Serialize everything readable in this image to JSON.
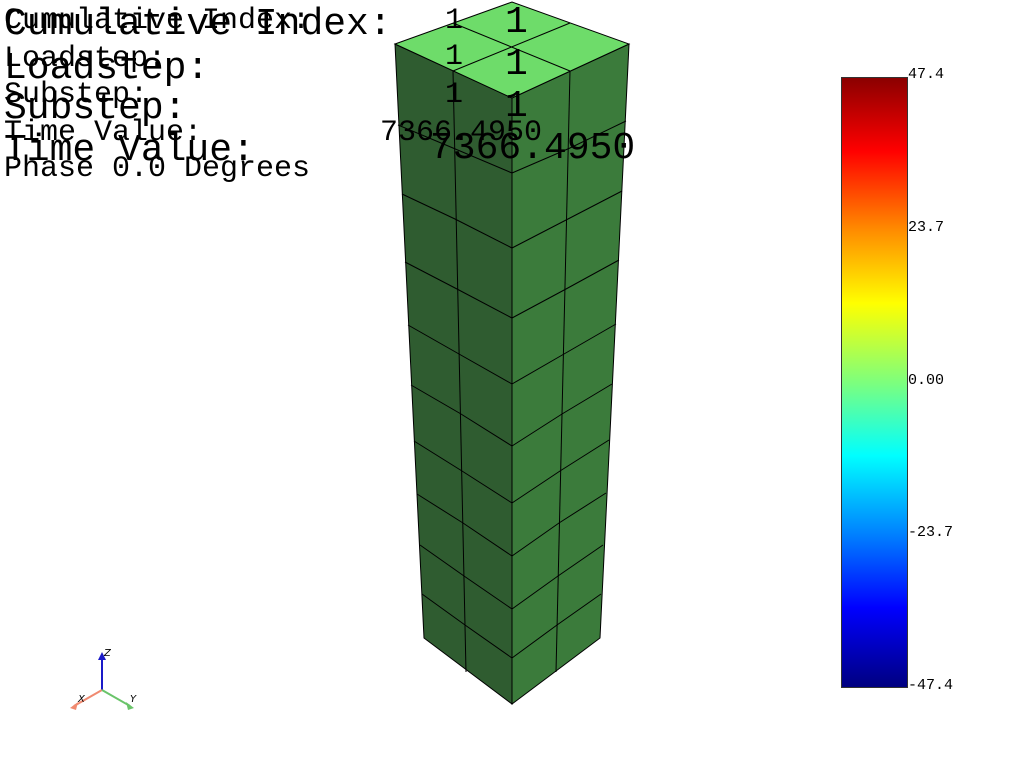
{
  "overlay": {
    "cumulative_index_label": "Cumulative Index:",
    "cumulative_index_value": "1",
    "loadstep_label": "Loadstep:",
    "loadstep_value": "1",
    "substep_label": "Substep:",
    "substep_value": "1",
    "time_value_label": "Time Value:",
    "time_value": "7366.4950",
    "phase_text": "Phase 0.0 Degrees"
  },
  "colorbar": {
    "ticks": [
      "47.4",
      "23.7",
      "0.00",
      "-23.7",
      "-47.4"
    ],
    "range": [
      -47.4,
      47.4
    ],
    "colors": [
      "#8b0000",
      "#ff0000",
      "#ff8c00",
      "#ffff00",
      "#7dff7d",
      "#00ffff",
      "#0080ff",
      "#0000ff",
      "#000080"
    ]
  },
  "mesh": {
    "top_face_color": "#6edc6a",
    "side_left_color": "#2f5c30",
    "side_right_color": "#3b7b3b"
  },
  "triad": {
    "x_label": "X",
    "y_label": "Y",
    "z_label": "Z",
    "x_color": "#f08a70",
    "y_color": "#6ac46a",
    "z_color": "#1a1ac8"
  }
}
